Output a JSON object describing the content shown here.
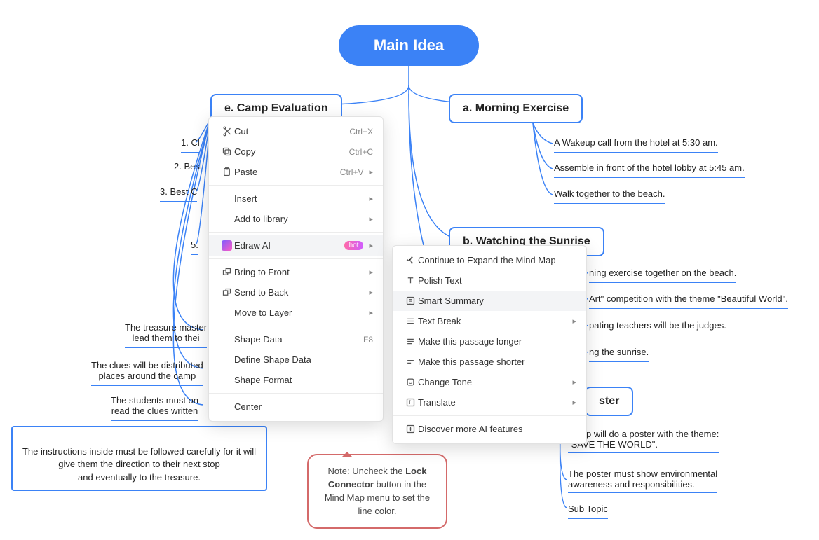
{
  "root": {
    "label": "Main Idea"
  },
  "branches": {
    "a": {
      "label": "a. Morning Exercise"
    },
    "b": {
      "label": "b. Watching the Sunrise"
    },
    "c": {
      "label": "ster"
    },
    "e": {
      "label": "e. Camp Evaluation"
    }
  },
  "a_items": [
    "A Wakeup call from the hotel at 5:30 am.",
    "Assemble in front of the hotel lobby at 5:45 am.",
    "Walk together to the beach."
  ],
  "b_items": [
    "ning exercise together on the beach.",
    "Art\" competition with the theme \"Beautiful World\".",
    "pating teachers will be the judges.",
    "ng the sunrise."
  ],
  "c_items": [
    "group will do a poster with the theme:\n\"SAVE THE WORLD\".",
    "The poster must show environmental\nawareness and responsibilities.",
    "Sub Topic"
  ],
  "e_items": [
    "1. Cl",
    "2. Best",
    "3. Best C",
    "5."
  ],
  "left_leaves": [
    "The treasure master\nlead them to thei",
    "The clues will be distributed\nplaces around the camp",
    "The students must on\nread the clues written"
  ],
  "big_leaf": "The instructions inside must be followed carefully for it will\ngive them the direction to their next stop\nand eventually to the treasure.",
  "note": {
    "pre": "Note: Uncheck the ",
    "bold": "Lock Connector",
    "post": " button in the Mind Map menu to set the line color."
  },
  "ctx": {
    "cut": {
      "lbl": "Cut",
      "sc": "Ctrl+X"
    },
    "copy": {
      "lbl": "Copy",
      "sc": "Ctrl+C"
    },
    "paste": {
      "lbl": "Paste",
      "sc": "Ctrl+V"
    },
    "insert": "Insert",
    "addlib": "Add to library",
    "ai": {
      "lbl": "Edraw AI",
      "badge": "hot"
    },
    "front": "Bring to Front",
    "back": "Send to Back",
    "layer": "Move to Layer",
    "sdata": {
      "lbl": "Shape Data",
      "sc": "F8"
    },
    "dsdata": "Define Shape Data",
    "sfmt": "Shape Format",
    "center": "Center"
  },
  "ai_sub": {
    "expand": "Continue to Expand the Mind Map",
    "polish": "Polish Text",
    "summary": "Smart Summary",
    "tbreak": "Text Break",
    "longer": "Make this passage longer",
    "shorter": "Make this passage shorter",
    "tone": "Change Tone",
    "translate": "Translate",
    "more": "Discover more AI features"
  }
}
